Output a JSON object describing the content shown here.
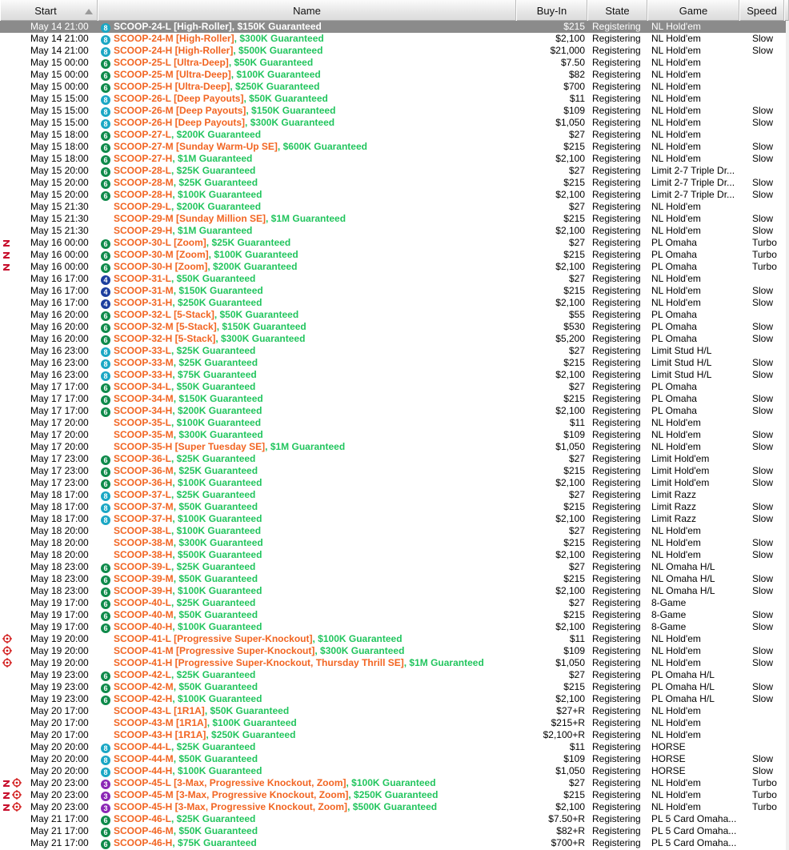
{
  "columns": {
    "start": "Start",
    "name": "Name",
    "buyin": "Buy-In",
    "state": "State",
    "game": "Game",
    "speed": "Speed"
  },
  "colors": {
    "name_primary": "#f26522",
    "name_secondary": "#22c55e",
    "badge_8": "#1aa7c4",
    "badge_6": "#0e8a4a",
    "badge_4": "#1c3f9e",
    "badge_3": "#8b27b5",
    "selected_row": "#8b8b8b",
    "zoom_icon": "#c8102e",
    "target_icon": "#d21a1a"
  },
  "tournaments": [
    {
      "start": "May 14 21:00",
      "badge": "8",
      "icons": [],
      "primary": "SCOOP-24-L [High-Roller]",
      "secondary": ", $150K Guaranteed",
      "buyin": "$215",
      "state": "Registering",
      "game": "NL Hold'em",
      "speed": "",
      "selected": true
    },
    {
      "start": "May 14 21:00",
      "badge": "8",
      "icons": [],
      "primary": "SCOOP-24-M [High-Roller]",
      "secondary": ", $300K Guaranteed",
      "buyin": "$2,100",
      "state": "Registering",
      "game": "NL Hold'em",
      "speed": "Slow"
    },
    {
      "start": "May 14 21:00",
      "badge": "8",
      "icons": [],
      "primary": "SCOOP-24-H [High-Roller]",
      "secondary": ", $500K Guaranteed",
      "buyin": "$21,000",
      "state": "Registering",
      "game": "NL Hold'em",
      "speed": "Slow"
    },
    {
      "start": "May 15 00:00",
      "badge": "6",
      "icons": [],
      "primary": "SCOOP-25-L [Ultra-Deep]",
      "secondary": ", $50K Guaranteed",
      "buyin": "$7.50",
      "state": "Registering",
      "game": "NL Hold'em",
      "speed": ""
    },
    {
      "start": "May 15 00:00",
      "badge": "6",
      "icons": [],
      "primary": "SCOOP-25-M [Ultra-Deep]",
      "secondary": ", $100K Guaranteed",
      "buyin": "$82",
      "state": "Registering",
      "game": "NL Hold'em",
      "speed": ""
    },
    {
      "start": "May 15 00:00",
      "badge": "6",
      "icons": [],
      "primary": "SCOOP-25-H [Ultra-Deep]",
      "secondary": ", $250K Guaranteed",
      "buyin": "$700",
      "state": "Registering",
      "game": "NL Hold'em",
      "speed": ""
    },
    {
      "start": "May 15 15:00",
      "badge": "8",
      "icons": [],
      "primary": "SCOOP-26-L [Deep Payouts]",
      "secondary": ", $50K Guaranteed",
      "buyin": "$11",
      "state": "Registering",
      "game": "NL Hold'em",
      "speed": ""
    },
    {
      "start": "May 15 15:00",
      "badge": "8",
      "icons": [],
      "primary": "SCOOP-26-M [Deep Payouts]",
      "secondary": ", $150K Guaranteed",
      "buyin": "$109",
      "state": "Registering",
      "game": "NL Hold'em",
      "speed": "Slow"
    },
    {
      "start": "May 15 15:00",
      "badge": "8",
      "icons": [],
      "primary": "SCOOP-26-H [Deep Payouts]",
      "secondary": ", $300K Guaranteed",
      "buyin": "$1,050",
      "state": "Registering",
      "game": "NL Hold'em",
      "speed": "Slow"
    },
    {
      "start": "May 15 18:00",
      "badge": "6",
      "icons": [],
      "primary": "SCOOP-27-L",
      "secondary": ", $200K Guaranteed",
      "buyin": "$27",
      "state": "Registering",
      "game": "NL Hold'em",
      "speed": ""
    },
    {
      "start": "May 15 18:00",
      "badge": "6",
      "icons": [],
      "primary": "SCOOP-27-M [Sunday Warm-Up SE]",
      "secondary": ", $600K Guaranteed",
      "buyin": "$215",
      "state": "Registering",
      "game": "NL Hold'em",
      "speed": "Slow"
    },
    {
      "start": "May 15 18:00",
      "badge": "6",
      "icons": [],
      "primary": "SCOOP-27-H",
      "secondary": ", $1M Guaranteed",
      "buyin": "$2,100",
      "state": "Registering",
      "game": "NL Hold'em",
      "speed": "Slow"
    },
    {
      "start": "May 15 20:00",
      "badge": "6",
      "icons": [],
      "primary": "SCOOP-28-L",
      "secondary": ", $25K Guaranteed",
      "buyin": "$27",
      "state": "Registering",
      "game": "Limit 2-7 Triple Dr...",
      "speed": ""
    },
    {
      "start": "May 15 20:00",
      "badge": "6",
      "icons": [],
      "primary": "SCOOP-28-M",
      "secondary": ", $25K Guaranteed",
      "buyin": "$215",
      "state": "Registering",
      "game": "Limit 2-7 Triple Dr...",
      "speed": "Slow"
    },
    {
      "start": "May 15 20:00",
      "badge": "6",
      "icons": [],
      "primary": "SCOOP-28-H",
      "secondary": ", $100K Guaranteed",
      "buyin": "$2,100",
      "state": "Registering",
      "game": "Limit 2-7 Triple Dr...",
      "speed": "Slow"
    },
    {
      "start": "May 15 21:30",
      "badge": "",
      "icons": [],
      "primary": "SCOOP-29-L",
      "secondary": ", $200K Guaranteed",
      "buyin": "$27",
      "state": "Registering",
      "game": "NL Hold'em",
      "speed": ""
    },
    {
      "start": "May 15 21:30",
      "badge": "",
      "icons": [],
      "primary": "SCOOP-29-M [Sunday Million SE]",
      "secondary": ", $1M Guaranteed",
      "buyin": "$215",
      "state": "Registering",
      "game": "NL Hold'em",
      "speed": "Slow"
    },
    {
      "start": "May 15 21:30",
      "badge": "",
      "icons": [],
      "primary": "SCOOP-29-H",
      "secondary": ", $1M Guaranteed",
      "buyin": "$2,100",
      "state": "Registering",
      "game": "NL Hold'em",
      "speed": "Slow"
    },
    {
      "start": "May 16 00:00",
      "badge": "6",
      "icons": [
        "zoom"
      ],
      "primary": "SCOOP-30-L [Zoom]",
      "secondary": ", $25K Guaranteed",
      "buyin": "$27",
      "state": "Registering",
      "game": "PL Omaha",
      "speed": "Turbo"
    },
    {
      "start": "May 16 00:00",
      "badge": "6",
      "icons": [
        "zoom"
      ],
      "primary": "SCOOP-30-M [Zoom]",
      "secondary": ", $100K Guaranteed",
      "buyin": "$215",
      "state": "Registering",
      "game": "PL Omaha",
      "speed": "Turbo"
    },
    {
      "start": "May 16 00:00",
      "badge": "6",
      "icons": [
        "zoom"
      ],
      "primary": "SCOOP-30-H [Zoom]",
      "secondary": ", $200K Guaranteed",
      "buyin": "$2,100",
      "state": "Registering",
      "game": "PL Omaha",
      "speed": "Turbo"
    },
    {
      "start": "May 16 17:00",
      "badge": "4",
      "icons": [],
      "primary": "SCOOP-31-L",
      "secondary": ", $50K Guaranteed",
      "buyin": "$27",
      "state": "Registering",
      "game": "NL Hold'em",
      "speed": ""
    },
    {
      "start": "May 16 17:00",
      "badge": "4",
      "icons": [],
      "primary": "SCOOP-31-M",
      "secondary": ", $150K Guaranteed",
      "buyin": "$215",
      "state": "Registering",
      "game": "NL Hold'em",
      "speed": "Slow"
    },
    {
      "start": "May 16 17:00",
      "badge": "4",
      "icons": [],
      "primary": "SCOOP-31-H",
      "secondary": ", $250K Guaranteed",
      "buyin": "$2,100",
      "state": "Registering",
      "game": "NL Hold'em",
      "speed": "Slow"
    },
    {
      "start": "May 16 20:00",
      "badge": "6",
      "icons": [],
      "primary": "SCOOP-32-L [5-Stack]",
      "secondary": ", $50K Guaranteed",
      "buyin": "$55",
      "state": "Registering",
      "game": "PL Omaha",
      "speed": ""
    },
    {
      "start": "May 16 20:00",
      "badge": "6",
      "icons": [],
      "primary": "SCOOP-32-M [5-Stack]",
      "secondary": ", $150K Guaranteed",
      "buyin": "$530",
      "state": "Registering",
      "game": "PL Omaha",
      "speed": "Slow"
    },
    {
      "start": "May 16 20:00",
      "badge": "6",
      "icons": [],
      "primary": "SCOOP-32-H [5-Stack]",
      "secondary": ", $300K Guaranteed",
      "buyin": "$5,200",
      "state": "Registering",
      "game": "PL Omaha",
      "speed": "Slow"
    },
    {
      "start": "May 16 23:00",
      "badge": "8",
      "icons": [],
      "primary": "SCOOP-33-L",
      "secondary": ", $25K Guaranteed",
      "buyin": "$27",
      "state": "Registering",
      "game": "Limit Stud H/L",
      "speed": ""
    },
    {
      "start": "May 16 23:00",
      "badge": "8",
      "icons": [],
      "primary": "SCOOP-33-M",
      "secondary": ", $25K Guaranteed",
      "buyin": "$215",
      "state": "Registering",
      "game": "Limit Stud H/L",
      "speed": "Slow"
    },
    {
      "start": "May 16 23:00",
      "badge": "8",
      "icons": [],
      "primary": "SCOOP-33-H",
      "secondary": ", $75K Guaranteed",
      "buyin": "$2,100",
      "state": "Registering",
      "game": "Limit Stud H/L",
      "speed": "Slow"
    },
    {
      "start": "May 17 17:00",
      "badge": "6",
      "icons": [],
      "primary": "SCOOP-34-L",
      "secondary": ", $50K Guaranteed",
      "buyin": "$27",
      "state": "Registering",
      "game": "PL Omaha",
      "speed": ""
    },
    {
      "start": "May 17 17:00",
      "badge": "6",
      "icons": [],
      "primary": "SCOOP-34-M",
      "secondary": ", $150K Guaranteed",
      "buyin": "$215",
      "state": "Registering",
      "game": "PL Omaha",
      "speed": "Slow"
    },
    {
      "start": "May 17 17:00",
      "badge": "6",
      "icons": [],
      "primary": "SCOOP-34-H",
      "secondary": ", $200K Guaranteed",
      "buyin": "$2,100",
      "state": "Registering",
      "game": "PL Omaha",
      "speed": "Slow"
    },
    {
      "start": "May 17 20:00",
      "badge": "",
      "icons": [],
      "primary": "SCOOP-35-L",
      "secondary": ", $100K Guaranteed",
      "buyin": "$11",
      "state": "Registering",
      "game": "NL Hold'em",
      "speed": ""
    },
    {
      "start": "May 17 20:00",
      "badge": "",
      "icons": [],
      "primary": "SCOOP-35-M",
      "secondary": ", $300K Guaranteed",
      "buyin": "$109",
      "state": "Registering",
      "game": "NL Hold'em",
      "speed": "Slow"
    },
    {
      "start": "May 17 20:00",
      "badge": "",
      "icons": [],
      "primary": "SCOOP-35-H [Super Tuesday SE]",
      "secondary": ", $1M Guaranteed",
      "buyin": "$1,050",
      "state": "Registering",
      "game": "NL Hold'em",
      "speed": "Slow"
    },
    {
      "start": "May 17 23:00",
      "badge": "6",
      "icons": [],
      "primary": "SCOOP-36-L",
      "secondary": ", $25K Guaranteed",
      "buyin": "$27",
      "state": "Registering",
      "game": "Limit Hold'em",
      "speed": ""
    },
    {
      "start": "May 17 23:00",
      "badge": "6",
      "icons": [],
      "primary": "SCOOP-36-M",
      "secondary": ", $25K Guaranteed",
      "buyin": "$215",
      "state": "Registering",
      "game": "Limit Hold'em",
      "speed": "Slow"
    },
    {
      "start": "May 17 23:00",
      "badge": "6",
      "icons": [],
      "primary": "SCOOP-36-H",
      "secondary": ", $100K Guaranteed",
      "buyin": "$2,100",
      "state": "Registering",
      "game": "Limit Hold'em",
      "speed": "Slow"
    },
    {
      "start": "May 18 17:00",
      "badge": "8",
      "icons": [],
      "primary": "SCOOP-37-L",
      "secondary": ", $25K Guaranteed",
      "buyin": "$27",
      "state": "Registering",
      "game": "Limit Razz",
      "speed": ""
    },
    {
      "start": "May 18 17:00",
      "badge": "8",
      "icons": [],
      "primary": "SCOOP-37-M",
      "secondary": ", $50K Guaranteed",
      "buyin": "$215",
      "state": "Registering",
      "game": "Limit Razz",
      "speed": "Slow"
    },
    {
      "start": "May 18 17:00",
      "badge": "8",
      "icons": [],
      "primary": "SCOOP-37-H",
      "secondary": ", $100K Guaranteed",
      "buyin": "$2,100",
      "state": "Registering",
      "game": "Limit Razz",
      "speed": "Slow"
    },
    {
      "start": "May 18 20:00",
      "badge": "",
      "icons": [],
      "primary": "SCOOP-38-L",
      "secondary": ", $100K Guaranteed",
      "buyin": "$27",
      "state": "Registering",
      "game": "NL Hold'em",
      "speed": ""
    },
    {
      "start": "May 18 20:00",
      "badge": "",
      "icons": [],
      "primary": "SCOOP-38-M",
      "secondary": ", $300K Guaranteed",
      "buyin": "$215",
      "state": "Registering",
      "game": "NL Hold'em",
      "speed": "Slow"
    },
    {
      "start": "May 18 20:00",
      "badge": "",
      "icons": [],
      "primary": "SCOOP-38-H",
      "secondary": ", $500K Guaranteed",
      "buyin": "$2,100",
      "state": "Registering",
      "game": "NL Hold'em",
      "speed": "Slow"
    },
    {
      "start": "May 18 23:00",
      "badge": "6",
      "icons": [],
      "primary": "SCOOP-39-L",
      "secondary": ", $25K Guaranteed",
      "buyin": "$27",
      "state": "Registering",
      "game": "NL Omaha H/L",
      "speed": ""
    },
    {
      "start": "May 18 23:00",
      "badge": "6",
      "icons": [],
      "primary": "SCOOP-39-M",
      "secondary": ", $50K Guaranteed",
      "buyin": "$215",
      "state": "Registering",
      "game": "NL Omaha H/L",
      "speed": "Slow"
    },
    {
      "start": "May 18 23:00",
      "badge": "6",
      "icons": [],
      "primary": "SCOOP-39-H",
      "secondary": ", $100K Guaranteed",
      "buyin": "$2,100",
      "state": "Registering",
      "game": "NL Omaha H/L",
      "speed": "Slow"
    },
    {
      "start": "May 19 17:00",
      "badge": "6",
      "icons": [],
      "primary": "SCOOP-40-L",
      "secondary": ", $25K Guaranteed",
      "buyin": "$27",
      "state": "Registering",
      "game": "8-Game",
      "speed": ""
    },
    {
      "start": "May 19 17:00",
      "badge": "6",
      "icons": [],
      "primary": "SCOOP-40-M",
      "secondary": ", $50K Guaranteed",
      "buyin": "$215",
      "state": "Registering",
      "game": "8-Game",
      "speed": "Slow"
    },
    {
      "start": "May 19 17:00",
      "badge": "6",
      "icons": [],
      "primary": "SCOOP-40-H",
      "secondary": ", $100K Guaranteed",
      "buyin": "$2,100",
      "state": "Registering",
      "game": "8-Game",
      "speed": "Slow"
    },
    {
      "start": "May 19 20:00",
      "badge": "",
      "icons": [
        "target"
      ],
      "primary": "SCOOP-41-L [Progressive Super-Knockout]",
      "secondary": ", $100K Guaranteed",
      "buyin": "$11",
      "state": "Registering",
      "game": "NL Hold'em",
      "speed": ""
    },
    {
      "start": "May 19 20:00",
      "badge": "",
      "icons": [
        "target"
      ],
      "primary": "SCOOP-41-M [Progressive Super-Knockout]",
      "secondary": ", $300K Guaranteed",
      "buyin": "$109",
      "state": "Registering",
      "game": "NL Hold'em",
      "speed": "Slow"
    },
    {
      "start": "May 19 20:00",
      "badge": "",
      "icons": [
        "target"
      ],
      "primary": "SCOOP-41-H [Progressive Super-Knockout, Thursday Thrill SE]",
      "secondary": ", $1M Guaranteed",
      "buyin": "$1,050",
      "state": "Registering",
      "game": "NL Hold'em",
      "speed": "Slow"
    },
    {
      "start": "May 19 23:00",
      "badge": "6",
      "icons": [],
      "primary": "SCOOP-42-L",
      "secondary": ", $25K Guaranteed",
      "buyin": "$27",
      "state": "Registering",
      "game": "PL Omaha H/L",
      "speed": ""
    },
    {
      "start": "May 19 23:00",
      "badge": "6",
      "icons": [],
      "primary": "SCOOP-42-M",
      "secondary": ", $50K Guaranteed",
      "buyin": "$215",
      "state": "Registering",
      "game": "PL Omaha H/L",
      "speed": "Slow"
    },
    {
      "start": "May 19 23:00",
      "badge": "6",
      "icons": [],
      "primary": "SCOOP-42-H",
      "secondary": ", $100K Guaranteed",
      "buyin": "$2,100",
      "state": "Registering",
      "game": "PL Omaha H/L",
      "speed": "Slow"
    },
    {
      "start": "May 20 17:00",
      "badge": "",
      "icons": [],
      "primary": "SCOOP-43-L [1R1A]",
      "secondary": ", $50K Guaranteed",
      "buyin": "$27+R",
      "state": "Registering",
      "game": "NL Hold'em",
      "speed": ""
    },
    {
      "start": "May 20 17:00",
      "badge": "",
      "icons": [],
      "primary": "SCOOP-43-M [1R1A]",
      "secondary": ", $100K Guaranteed",
      "buyin": "$215+R",
      "state": "Registering",
      "game": "NL Hold'em",
      "speed": ""
    },
    {
      "start": "May 20 17:00",
      "badge": "",
      "icons": [],
      "primary": "SCOOP-43-H [1R1A]",
      "secondary": ", $250K Guaranteed",
      "buyin": "$2,100+R",
      "state": "Registering",
      "game": "NL Hold'em",
      "speed": ""
    },
    {
      "start": "May 20 20:00",
      "badge": "8",
      "icons": [],
      "primary": "SCOOP-44-L",
      "secondary": ", $25K Guaranteed",
      "buyin": "$11",
      "state": "Registering",
      "game": "HORSE",
      "speed": ""
    },
    {
      "start": "May 20 20:00",
      "badge": "8",
      "icons": [],
      "primary": "SCOOP-44-M",
      "secondary": ", $50K Guaranteed",
      "buyin": "$109",
      "state": "Registering",
      "game": "HORSE",
      "speed": "Slow"
    },
    {
      "start": "May 20 20:00",
      "badge": "8",
      "icons": [],
      "primary": "SCOOP-44-H",
      "secondary": ", $100K Guaranteed",
      "buyin": "$1,050",
      "state": "Registering",
      "game": "HORSE",
      "speed": "Slow"
    },
    {
      "start": "May 20 23:00",
      "badge": "3",
      "icons": [
        "zoom",
        "target"
      ],
      "primary": "SCOOP-45-L [3-Max, Progressive Knockout, Zoom]",
      "secondary": ", $100K Guaranteed",
      "buyin": "$27",
      "state": "Registering",
      "game": "NL Hold'em",
      "speed": "Turbo"
    },
    {
      "start": "May 20 23:00",
      "badge": "3",
      "icons": [
        "zoom",
        "target"
      ],
      "primary": "SCOOP-45-M [3-Max, Progressive Knockout, Zoom]",
      "secondary": ", $250K Guaranteed",
      "buyin": "$215",
      "state": "Registering",
      "game": "NL Hold'em",
      "speed": "Turbo"
    },
    {
      "start": "May 20 23:00",
      "badge": "3",
      "icons": [
        "zoom",
        "target"
      ],
      "primary": "SCOOP-45-H [3-Max, Progressive Knockout, Zoom]",
      "secondary": ", $500K Guaranteed",
      "buyin": "$2,100",
      "state": "Registering",
      "game": "NL Hold'em",
      "speed": "Turbo"
    },
    {
      "start": "May 21 17:00",
      "badge": "6",
      "icons": [],
      "primary": "SCOOP-46-L",
      "secondary": ", $25K Guaranteed",
      "buyin": "$7.50+R",
      "state": "Registering",
      "game": "PL 5 Card Omaha...",
      "speed": ""
    },
    {
      "start": "May 21 17:00",
      "badge": "6",
      "icons": [],
      "primary": "SCOOP-46-M",
      "secondary": ", $50K Guaranteed",
      "buyin": "$82+R",
      "state": "Registering",
      "game": "PL 5 Card Omaha...",
      "speed": ""
    },
    {
      "start": "May 21 17:00",
      "badge": "6",
      "icons": [],
      "primary": "SCOOP-46-H",
      "secondary": ", $75K Guaranteed",
      "buyin": "$700+R",
      "state": "Registering",
      "game": "PL 5 Card Omaha...",
      "speed": ""
    }
  ]
}
